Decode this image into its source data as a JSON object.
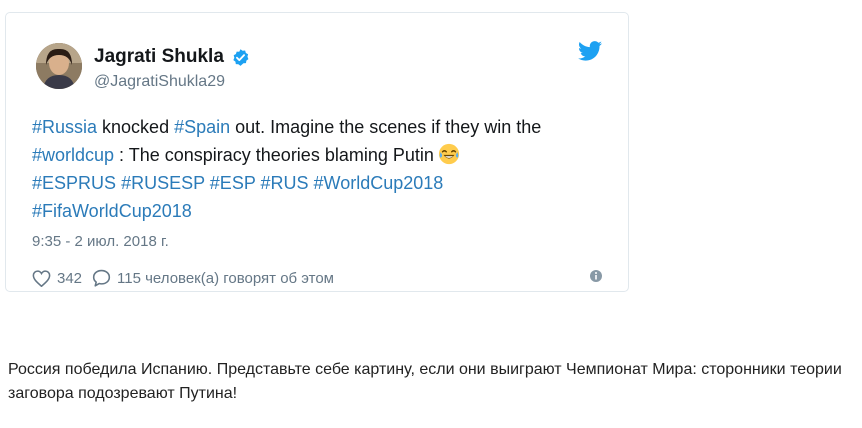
{
  "tweet": {
    "display_name": "Jagrati Shukla",
    "handle": "@JagratiShukla29",
    "text": {
      "h_russia": "#Russia",
      "t1": " knocked ",
      "h_spain": "#Spain",
      "t2": " out. Imagine the scenes if they win the ",
      "h_worldcup": "#worldcup",
      "t3": " : The conspiracy theories blaming Putin",
      "tags_line1": [
        "#ESPRUS",
        "#RUSESP",
        "#ESP",
        "#RUS",
        "#WorldCup2018"
      ],
      "tags_line2": [
        "#FifaWorldCup2018"
      ]
    },
    "timestamp": "9:35 - 2 июл. 2018 г.",
    "likes": "342",
    "replies_text": "115 человек(а) говорят об этом"
  },
  "translation": "Россия победила Испанию. Представьте себе картину, если они выиграют Чемпионат Мира: сторонники теории заговора подозревают Путина!",
  "colors": {
    "hashtag": "#2b7bb9",
    "verified": "#1da1f2",
    "muted": "#657786"
  },
  "icons": {
    "verified": "verified-badge-icon",
    "bird": "twitter-bird-icon",
    "like": "heart-icon",
    "reply": "speech-bubble-icon",
    "info": "info-icon",
    "emoji": "tears-of-joy-emoji"
  }
}
